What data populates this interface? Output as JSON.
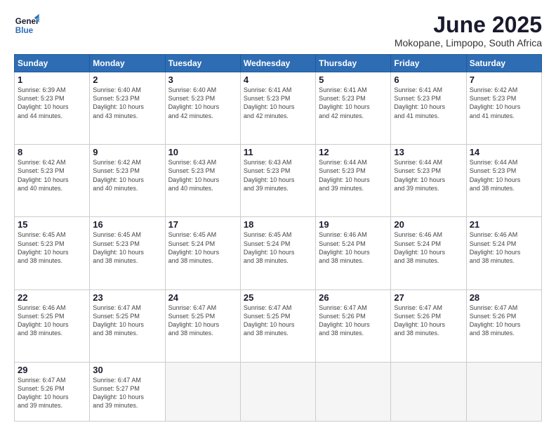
{
  "logo": {
    "line1": "General",
    "line2": "Blue"
  },
  "title": "June 2025",
  "location": "Mokopane, Limpopo, South Africa",
  "weekdays": [
    "Sunday",
    "Monday",
    "Tuesday",
    "Wednesday",
    "Thursday",
    "Friday",
    "Saturday"
  ],
  "days": [
    {
      "num": "",
      "info": ""
    },
    {
      "num": "",
      "info": ""
    },
    {
      "num": "",
      "info": ""
    },
    {
      "num": "",
      "info": ""
    },
    {
      "num": "",
      "info": ""
    },
    {
      "num": "",
      "info": ""
    },
    {
      "num": "7",
      "info": "Sunrise: 6:42 AM\nSunset: 5:23 PM\nDaylight: 10 hours\nand 41 minutes."
    },
    {
      "num": "8",
      "info": "Sunrise: 6:42 AM\nSunset: 5:23 PM\nDaylight: 10 hours\nand 40 minutes."
    },
    {
      "num": "9",
      "info": "Sunrise: 6:42 AM\nSunset: 5:23 PM\nDaylight: 10 hours\nand 40 minutes."
    },
    {
      "num": "10",
      "info": "Sunrise: 6:43 AM\nSunset: 5:23 PM\nDaylight: 10 hours\nand 40 minutes."
    },
    {
      "num": "11",
      "info": "Sunrise: 6:43 AM\nSunset: 5:23 PM\nDaylight: 10 hours\nand 39 minutes."
    },
    {
      "num": "12",
      "info": "Sunrise: 6:44 AM\nSunset: 5:23 PM\nDaylight: 10 hours\nand 39 minutes."
    },
    {
      "num": "13",
      "info": "Sunrise: 6:44 AM\nSunset: 5:23 PM\nDaylight: 10 hours\nand 39 minutes."
    },
    {
      "num": "14",
      "info": "Sunrise: 6:44 AM\nSunset: 5:23 PM\nDaylight: 10 hours\nand 38 minutes."
    },
    {
      "num": "15",
      "info": "Sunrise: 6:45 AM\nSunset: 5:23 PM\nDaylight: 10 hours\nand 38 minutes."
    },
    {
      "num": "16",
      "info": "Sunrise: 6:45 AM\nSunset: 5:23 PM\nDaylight: 10 hours\nand 38 minutes."
    },
    {
      "num": "17",
      "info": "Sunrise: 6:45 AM\nSunset: 5:24 PM\nDaylight: 10 hours\nand 38 minutes."
    },
    {
      "num": "18",
      "info": "Sunrise: 6:45 AM\nSunset: 5:24 PM\nDaylight: 10 hours\nand 38 minutes."
    },
    {
      "num": "19",
      "info": "Sunrise: 6:46 AM\nSunset: 5:24 PM\nDaylight: 10 hours\nand 38 minutes."
    },
    {
      "num": "20",
      "info": "Sunrise: 6:46 AM\nSunset: 5:24 PM\nDaylight: 10 hours\nand 38 minutes."
    },
    {
      "num": "21",
      "info": "Sunrise: 6:46 AM\nSunset: 5:24 PM\nDaylight: 10 hours\nand 38 minutes."
    },
    {
      "num": "22",
      "info": "Sunrise: 6:46 AM\nSunset: 5:25 PM\nDaylight: 10 hours\nand 38 minutes."
    },
    {
      "num": "23",
      "info": "Sunrise: 6:47 AM\nSunset: 5:25 PM\nDaylight: 10 hours\nand 38 minutes."
    },
    {
      "num": "24",
      "info": "Sunrise: 6:47 AM\nSunset: 5:25 PM\nDaylight: 10 hours\nand 38 minutes."
    },
    {
      "num": "25",
      "info": "Sunrise: 6:47 AM\nSunset: 5:25 PM\nDaylight: 10 hours\nand 38 minutes."
    },
    {
      "num": "26",
      "info": "Sunrise: 6:47 AM\nSunset: 5:26 PM\nDaylight: 10 hours\nand 38 minutes."
    },
    {
      "num": "27",
      "info": "Sunrise: 6:47 AM\nSunset: 5:26 PM\nDaylight: 10 hours\nand 38 minutes."
    },
    {
      "num": "28",
      "info": "Sunrise: 6:47 AM\nSunset: 5:26 PM\nDaylight: 10 hours\nand 38 minutes."
    },
    {
      "num": "29",
      "info": "Sunrise: 6:47 AM\nSunset: 5:26 PM\nDaylight: 10 hours\nand 39 minutes."
    },
    {
      "num": "30",
      "info": "Sunrise: 6:47 AM\nSunset: 5:27 PM\nDaylight: 10 hours\nand 39 minutes."
    },
    {
      "num": "",
      "info": ""
    },
    {
      "num": "",
      "info": ""
    },
    {
      "num": "",
      "info": ""
    },
    {
      "num": "",
      "info": ""
    },
    {
      "num": "",
      "info": ""
    }
  ],
  "row1": [
    {
      "num": "1",
      "info": "Sunrise: 6:39 AM\nSunset: 5:23 PM\nDaylight: 10 hours\nand 44 minutes."
    },
    {
      "num": "2",
      "info": "Sunrise: 6:40 AM\nSunset: 5:23 PM\nDaylight: 10 hours\nand 43 minutes."
    },
    {
      "num": "3",
      "info": "Sunrise: 6:40 AM\nSunset: 5:23 PM\nDaylight: 10 hours\nand 42 minutes."
    },
    {
      "num": "4",
      "info": "Sunrise: 6:41 AM\nSunset: 5:23 PM\nDaylight: 10 hours\nand 42 minutes."
    },
    {
      "num": "5",
      "info": "Sunrise: 6:41 AM\nSunset: 5:23 PM\nDaylight: 10 hours\nand 42 minutes."
    },
    {
      "num": "6",
      "info": "Sunrise: 6:41 AM\nSunset: 5:23 PM\nDaylight: 10 hours\nand 41 minutes."
    },
    {
      "num": "7",
      "info": "Sunrise: 6:42 AM\nSunset: 5:23 PM\nDaylight: 10 hours\nand 41 minutes."
    }
  ]
}
